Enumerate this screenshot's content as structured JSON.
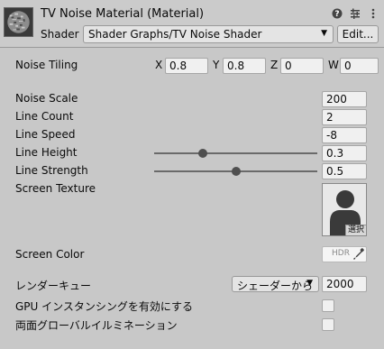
{
  "header": {
    "title": "TV Noise Material (Material)",
    "shader_label": "Shader",
    "shader_value": "Shader Graphs/TV Noise Shader",
    "edit_label": "Edit...",
    "icons": [
      "help-icon",
      "preset-icon",
      "overflow-menu-icon"
    ]
  },
  "props": {
    "noise_tiling": {
      "label": "Noise Tiling",
      "x_label": "X",
      "x": "0.8",
      "y_label": "Y",
      "y": "0.8",
      "z_label": "Z",
      "z": "0",
      "w_label": "W",
      "w": "0"
    },
    "noise_scale": {
      "label": "Noise Scale",
      "value": "200"
    },
    "line_count": {
      "label": "Line Count",
      "value": "2"
    },
    "line_speed": {
      "label": "Line Speed",
      "value": "-8"
    },
    "line_height": {
      "label": "Line Height",
      "value": "0.3",
      "slider_fraction": 0.3
    },
    "line_strength": {
      "label": "Line Strength",
      "value": "0.5",
      "slider_fraction": 0.5
    },
    "screen_texture": {
      "label": "Screen Texture",
      "select_label": "選択"
    },
    "screen_color": {
      "label": "Screen Color",
      "hdr_label": "HDR"
    },
    "render_queue": {
      "label": "レンダーキュー",
      "mode": "シェーダーから",
      "value": "2000"
    },
    "gpu_instancing": {
      "label": "GPU インスタンシングを有効にする",
      "checked": false
    },
    "double_sided_gi": {
      "label": "両面グローバルイルミネーション",
      "checked": false
    }
  },
  "colors": {
    "background": "#c8c8c8",
    "field": "#f0f0f0",
    "slider_knob": "#4f4f4f"
  }
}
